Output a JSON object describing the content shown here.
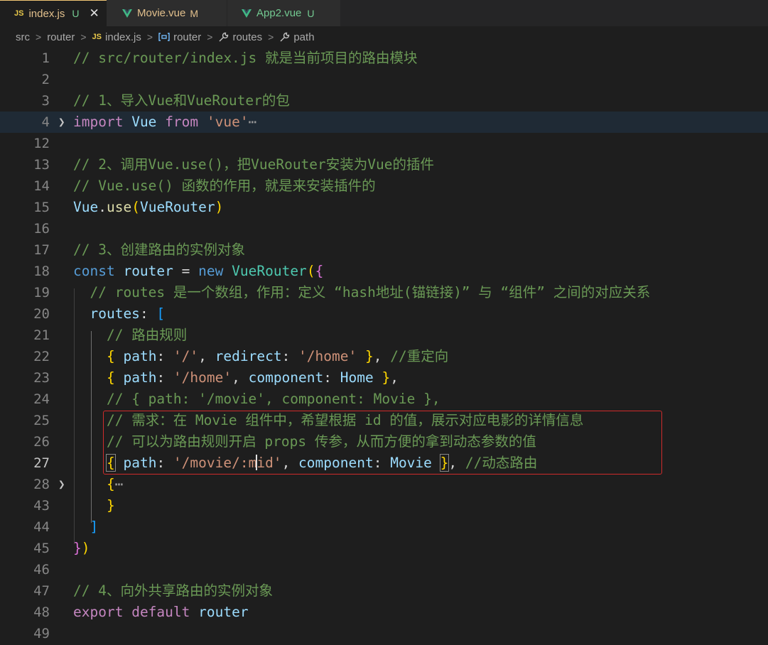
{
  "tabs": [
    {
      "icon": "js-icon",
      "name": "index.js",
      "status": "U",
      "status_color": "#73c991",
      "name_color": "#e2c08d",
      "active": true,
      "close": "✕"
    },
    {
      "icon": "vue-icon",
      "name": "Movie.vue",
      "status": "M",
      "status_color": "#e2c08d",
      "name_color": "#e2c08d",
      "active": false
    },
    {
      "icon": "vue-icon",
      "name": "App2.vue",
      "status": "U",
      "status_color": "#73c991",
      "name_color": "#73c991",
      "active": false
    }
  ],
  "breadcrumbs": [
    {
      "label": "src"
    },
    {
      "label": "router"
    },
    {
      "label": "index.js",
      "icon": "js-icon"
    },
    {
      "label": "router",
      "icon": "variable-icon"
    },
    {
      "label": "routes",
      "icon": "wrench-icon"
    },
    {
      "label": "path",
      "icon": "wrench-icon"
    }
  ],
  "separator": ">",
  "line_numbers": [
    "1",
    "2",
    "3",
    "4",
    "12",
    "13",
    "14",
    "15",
    "16",
    "17",
    "18",
    "19",
    "20",
    "21",
    "22",
    "23",
    "24",
    "25",
    "26",
    "27",
    "28",
    "43",
    "44",
    "45",
    "46",
    "47",
    "48",
    "49"
  ],
  "code": {
    "l1": "// src/router/index.js 就是当前项目的路由模块",
    "l3": "// 1、导入Vue和VueRouter的包",
    "l4_import": "import",
    "l4_vue": "Vue",
    "l4_from": "from",
    "l4_str": "'vue'",
    "l4_ellipsis": "⋯",
    "l13": "// 2、调用Vue.use()，把VueRouter安装为Vue的插件",
    "l14": "// Vue.use() 函数的作用，就是来安装插件的",
    "l15_vue": "Vue",
    "l15_use": "use",
    "l15_arg": "VueRouter",
    "l17": "// 3、创建路由的实例对象",
    "l18_const": "const",
    "l18_router": "router",
    "l18_new": "new",
    "l18_class": "VueRouter",
    "l19": "// routes 是一个数组，作用：定义 “hash地址(锚链接)” 与 “组件” 之间的对应关系",
    "l20_routes": "routes",
    "l21": "// 路由规则",
    "l22_path": "path",
    "l22_pathval": "'/'",
    "l22_redirect": "redirect",
    "l22_redirectval": "'/home'",
    "l22_comment": "//重定向",
    "l23_path": "path",
    "l23_pathval": "'/home'",
    "l23_component": "component",
    "l23_compval": "Home",
    "l24": "// { path: '/movie', component: Movie },",
    "l25": "// 需求：在 Movie 组件中，希望根据 id 的值，展示对应电影的详情信息",
    "l26": "// 可以为路由规则开启 props 传参，从而方便的拿到动态参数的值",
    "l27_path": "path",
    "l27_pathval_a": "'/movie/:m",
    "l27_pathval_b": "id'",
    "l27_component": "component",
    "l27_compval": "Movie",
    "l27_comment": "//动态路由",
    "l28_ellipsis": "⋯",
    "l47": "// 4、向外共享路由的实例对象",
    "l48_export": "export",
    "l48_default": "default",
    "l48_router": "router"
  }
}
